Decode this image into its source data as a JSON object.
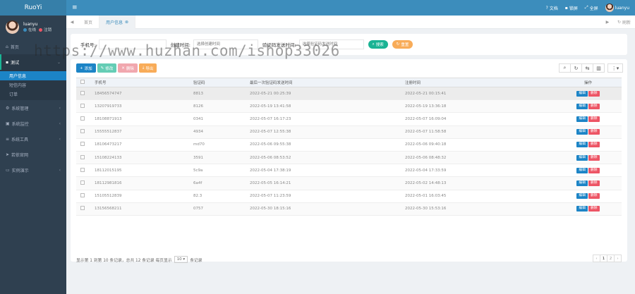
{
  "app": {
    "logo": "RuoYi"
  },
  "user": {
    "name": "luanyu",
    "status_online": "在线",
    "status_logout": "注销"
  },
  "sidebar": {
    "items": [
      {
        "label": "首页",
        "icon": "home-icon"
      },
      {
        "label": "测试",
        "icon": "chat-icon",
        "sub": [
          "用户信息",
          "短信内容",
          "订单"
        ]
      },
      {
        "label": "系统管理",
        "icon": "gear-icon"
      },
      {
        "label": "系统监控",
        "icon": "monitor-icon"
      },
      {
        "label": "系统工具",
        "icon": "tools-icon"
      },
      {
        "label": "若依官网",
        "icon": "location-icon"
      },
      {
        "label": "实例演示",
        "icon": "desktop-icon"
      }
    ]
  },
  "topbar": {
    "docs": "文档",
    "lock": "锁屏",
    "fullscreen": "全屏",
    "username": "luanyu"
  },
  "tabs": {
    "home": "首页",
    "current": "用户信息",
    "refresh": "刷新"
  },
  "search": {
    "phone_label": "手机号:",
    "phone_value": "",
    "time_label": "创建时间:",
    "time_placeholder": "选择创建时间",
    "code_time_label": "验证码发送时间:",
    "code_time_placeholder": "选择验证码发送时间",
    "search_btn": "搜索",
    "reset_btn": "重置"
  },
  "toolbar": {
    "add": "添加",
    "edit": "修改",
    "delete": "删除",
    "export": "导出"
  },
  "table": {
    "headers": [
      "手机号",
      "验证码",
      "最后一次验证码发送时间",
      "注册时间",
      "操作"
    ],
    "rows": [
      [
        "18456574747",
        "8813",
        "2022-05-21 00:25:39",
        "2022-05-21 00:15:41"
      ],
      [
        "13207919733",
        "8126",
        "2022-05-19 13:41:58",
        "2022-05-19 13:36:18"
      ],
      [
        "18108871913",
        "0341",
        "2022-05-07 16:17:23",
        "2022-05-07 16:09:04"
      ],
      [
        "15555512837",
        "4934",
        "2022-05-07 12:55:38",
        "2022-05-07 11:58:58"
      ],
      [
        "18106473217",
        "md70",
        "2022-05-06 09:55:38",
        "2022-05-06 09:40:18"
      ],
      [
        "15108224133",
        "3591",
        "2022-05-06 08:53:52",
        "2022-05-06 08:48:32"
      ],
      [
        "18112015195",
        "5c9a",
        "2022-05-04 17:38:19",
        "2022-05-04 17:33:59"
      ],
      [
        "18112981816",
        "6a4f",
        "2022-05-05 16:14:21",
        "2022-05-02 14:48:13"
      ],
      [
        "15105512839",
        "82.3",
        "2022-05-07 11:23:59",
        "2022-05-01 16:03:45"
      ],
      [
        "13156568211",
        "0757",
        "2022-05-30 18:15:16",
        "2022-05-30 15:53:16"
      ]
    ],
    "op_edit": "编辑",
    "op_delete": "删除"
  },
  "pager": {
    "info": "显示第 1 到第 10 条记录，总共 12 条记录 每页显示",
    "page_size": "10",
    "suffix": "条记录",
    "prev": "‹",
    "pages": [
      "1",
      "2"
    ],
    "next": "›"
  },
  "watermark": "https://www.huzhan.com/ishop33026"
}
